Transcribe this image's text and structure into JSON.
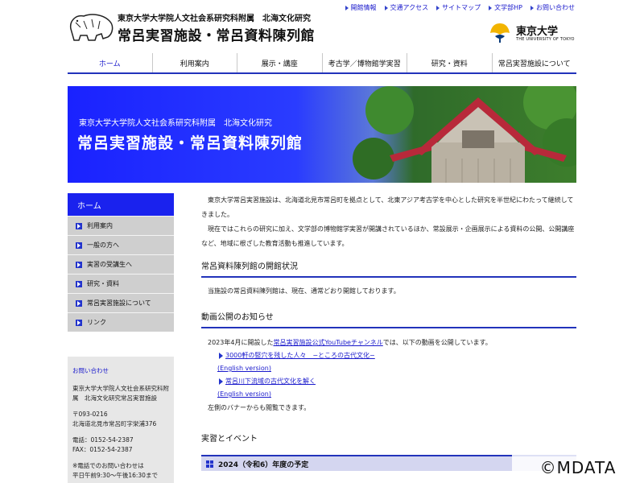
{
  "header": {
    "org_sub": "東京大学大学院人文社会系研究科附属　北海文化研究",
    "org_main": "常呂実習施設・常呂資料陳列館",
    "util_links": [
      "開館情報",
      "交通アクセス",
      "サイトマップ",
      "文学部HP",
      "お問い合わせ"
    ],
    "univ_name": "東京大学",
    "univ_en": "THE UNIVERSITY OF TOKYO"
  },
  "gnav": [
    "ホーム",
    "利用案内",
    "展示・講座",
    "考古学／博物館学実習",
    "研究・資料",
    "常呂実習施設について"
  ],
  "banner": {
    "sub": "東京大学大学院人文社会系研究科附属　北海文化研究",
    "main": "常呂実習施設・常呂資料陳列館"
  },
  "sidebar": {
    "home": "ホーム",
    "items": [
      "利用案内",
      "一般の方へ",
      "実習の受講生へ",
      "研究・資料",
      "常呂実習施設について",
      "リンク"
    ]
  },
  "contact": {
    "title": "お問い合わせ",
    "org": "東京大学大学院人文社会系研究科附属　北海文化研究常呂実習施設",
    "zip": "〒093-0216",
    "address": "北海道北見市常呂町字栄浦376",
    "tel": "電話：0152-54-2387",
    "fax": "FAX：0152-54-2387",
    "note1": "※電話でのお問い合わせは",
    "note2": "平日午前9:30〜午後16:30まで"
  },
  "main": {
    "intro_1": "東京大学常呂実習施設は、北海道北見市常呂町を拠点として、北東アジア考古学を中心とした研究を半世紀にわたって継続してきました。",
    "intro_2": "現在ではこれらの研究に加え、文学部の博物館学実習が開講されているほか、常設展示・企画展示による資料の公開、公開講座など、地域に根ざした教育活動も推進しています。",
    "sec1_title": "常呂資料陳列館の開館状況",
    "sec1_text": "当施設の常呂資料陳列館は、現在、通常どおり開館しております。",
    "sec2_title": "動画公開のお知らせ",
    "yt_pre": "2023年4月に開設した",
    "yt_link": "常呂実習施設公式YouTubeチャンネル",
    "yt_post": "では、以下の動画を公開しています。",
    "video1": "3000軒の竪穴を残した人々　−ところの古代文化−",
    "video1_en": "(English version)",
    "video2": "常呂川下流域の古代文化を解く",
    "video2_en": "(English version)",
    "note": "左側のバナーからも閲覧できます。",
    "sec3_title": "実習とイベント",
    "event_title": "2024（令和6）年度の予定"
  },
  "watermark": "©MDATA",
  "colors": {
    "accent": "#2233bb",
    "link": "#1a1acc",
    "sidebar_bg": "#cfcfcf"
  }
}
